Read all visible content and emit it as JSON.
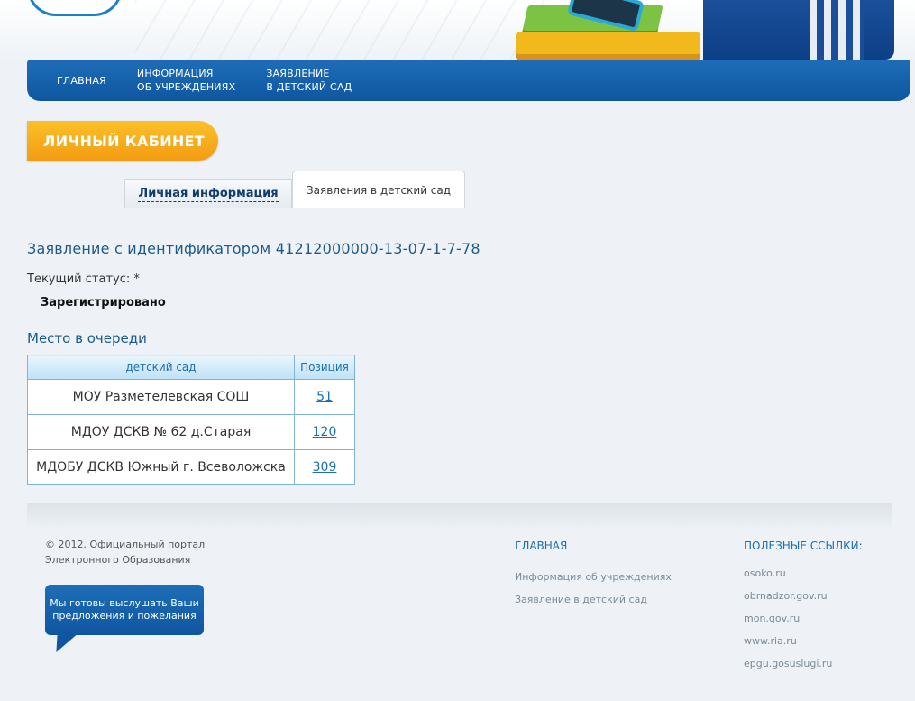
{
  "nav": {
    "items": [
      {
        "line1": "ГЛАВНАЯ",
        "line2": ""
      },
      {
        "line1": "ИНФОРМАЦИЯ",
        "line2": "ОБ УЧРЕЖДЕНИЯХ"
      },
      {
        "line1": "ЗАЯВЛЕНИЕ",
        "line2": "В ДЕТСКИЙ САД"
      }
    ]
  },
  "cabinet_title": "ЛИЧНЫЙ КАБИНЕТ",
  "tabs": {
    "personal": "Личная информация",
    "applications": "Заявления в детский сад"
  },
  "application": {
    "title": "Заявление с идентификатором 41212000000-13-07-1-7-78",
    "status_label": "Текущий статус: *",
    "status_value": "Зарегистрировано"
  },
  "queue": {
    "title": "Место в очереди",
    "headers": [
      "детский сад",
      "Позиция"
    ],
    "rows": [
      {
        "name": "МОУ Разметелевская СОШ",
        "position": "51"
      },
      {
        "name": "МДОУ ДСКВ № 62 д.Старая",
        "position": "120"
      },
      {
        "name": "МДОБУ ДСКВ Южный г. Всеволожска",
        "position": "309"
      }
    ]
  },
  "footer": {
    "copyright_line1": "© 2012. Официальный портал",
    "copyright_line2": "Электронного Образования",
    "feedback": "Мы готовы выслушать Ваши предложения и пожелания",
    "main_heading": "ГЛАВНАЯ",
    "main_links": [
      "Информация об учреждениях",
      "Заявление в детский сад"
    ],
    "useful_heading": "ПОЛЕЗНЫЕ ССЫЛКИ:",
    "useful_links": [
      "osoko.ru",
      "obrnadzor.gov.ru",
      "mon.gov.ru",
      "www.ria.ru",
      "epgu.gosuslugi.ru"
    ]
  }
}
